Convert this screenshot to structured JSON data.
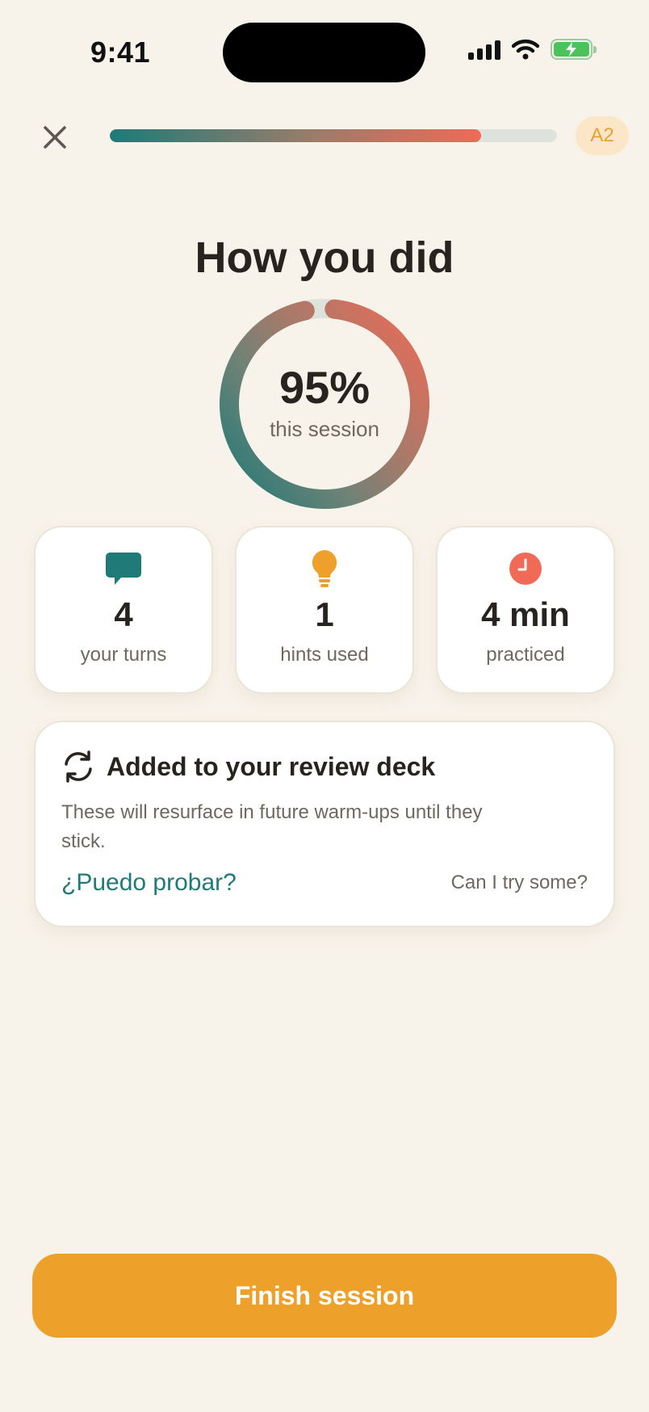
{
  "status_bar": {
    "time": "9:41"
  },
  "header": {
    "progress_percent": 83,
    "level_badge": "A2"
  },
  "summary": {
    "title": "How you did",
    "score": "95%",
    "score_label": "this session",
    "score_value": 95
  },
  "stats": [
    {
      "value": "4",
      "label": "your turns",
      "icon": "chat-bubble-icon",
      "color": "#1f7a78"
    },
    {
      "value": "1",
      "label": "hints used",
      "icon": "lightbulb-icon",
      "color": "#eda12b"
    },
    {
      "value": "4 min",
      "label": "practiced",
      "icon": "clock-icon",
      "color": "#ef6a57"
    }
  ],
  "review": {
    "title": "Added to your review deck",
    "description": "These will resurface in future warm-ups until they stick.",
    "phrases": [
      {
        "spanish": "¿Puedo probar?",
        "english": "Can I try some?"
      }
    ]
  },
  "footer": {
    "finish_label": "Finish session"
  },
  "colors": {
    "background": "#f8f3ea",
    "teal": "#1f7a78",
    "coral": "#ef6a57",
    "amber": "#eda12b"
  }
}
